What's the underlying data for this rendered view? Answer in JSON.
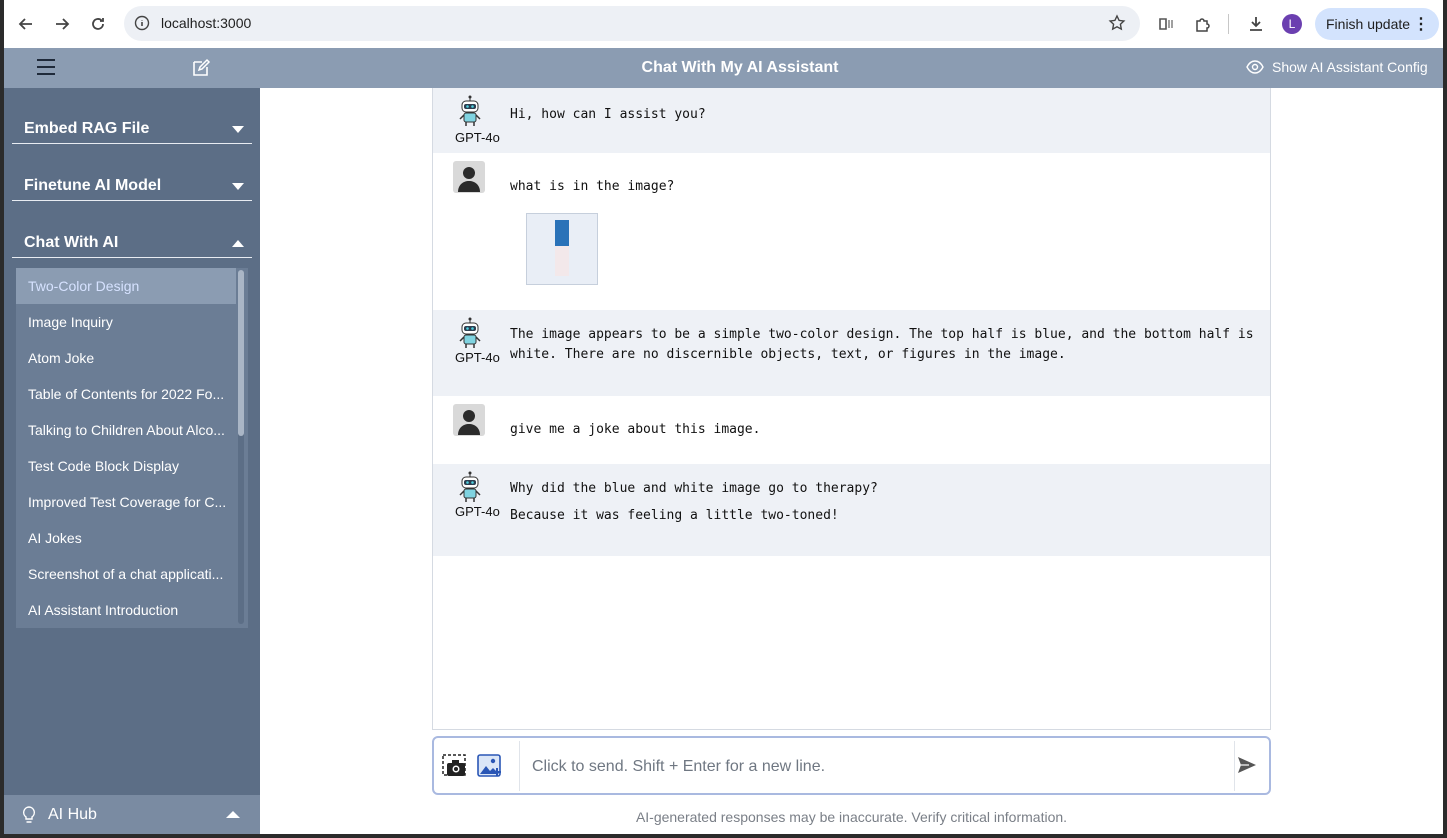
{
  "browser": {
    "url": "localhost:3000",
    "finish_update": "Finish update",
    "profile_initial": "L"
  },
  "header": {
    "title": "Chat With My AI Assistant",
    "config_label": "Show AI Assistant Config"
  },
  "sidebar": {
    "sections": [
      {
        "label": "Embed RAG File",
        "expanded": false
      },
      {
        "label": "Finetune AI Model",
        "expanded": false
      },
      {
        "label": "Chat With AI",
        "expanded": true
      }
    ],
    "chats": [
      "Two-Color Design",
      "Image Inquiry",
      "Atom Joke",
      "Table of Contents for 2022 Fo...",
      "Talking to Children About Alco...",
      "Test Code Block Display",
      "Improved Test Coverage for C...",
      "AI Jokes",
      "Screenshot of a chat applicati...",
      "AI Assistant Introduction"
    ],
    "active_chat": "Two-Color Design",
    "hub_label": "AI Hub"
  },
  "messages": [
    {
      "role": "assistant",
      "model": "GPT-4o",
      "lines": [
        "Hi, how can I assist you?"
      ]
    },
    {
      "role": "user",
      "lines": [
        "what is in the image?"
      ],
      "has_image": true
    },
    {
      "role": "assistant",
      "model": "GPT-4o",
      "lines": [
        "The image appears to be a simple two-color design. The top half is blue, and the bottom half is",
        "white. There are no discernible objects, text, or figures in the image."
      ]
    },
    {
      "role": "user",
      "lines": [
        "give me a joke about this image."
      ]
    },
    {
      "role": "assistant",
      "model": "GPT-4o",
      "lines": [
        "Why did the blue and white image go to therapy?",
        "Because it was feeling a little two-toned!"
      ]
    }
  ],
  "input": {
    "placeholder": "Click to send. Shift + Enter for a new line."
  },
  "disclaimer": "AI-generated responses may be inaccurate. Verify critical information.",
  "colors": {
    "header": "#8b9cb2",
    "sidebar": "#5c6e86",
    "bot_row": "#eef1f6"
  }
}
